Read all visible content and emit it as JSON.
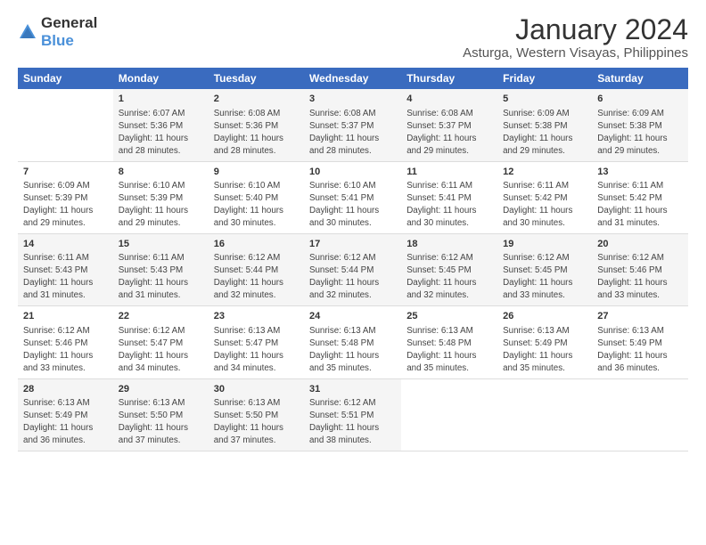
{
  "logo": {
    "general": "General",
    "blue": "Blue"
  },
  "title": "January 2024",
  "subtitle": "Asturga, Western Visayas, Philippines",
  "days_of_week": [
    "Sunday",
    "Monday",
    "Tuesday",
    "Wednesday",
    "Thursday",
    "Friday",
    "Saturday"
  ],
  "weeks": [
    [
      {
        "day": "",
        "info": ""
      },
      {
        "day": "1",
        "info": "Sunrise: 6:07 AM\nSunset: 5:36 PM\nDaylight: 11 hours\nand 28 minutes."
      },
      {
        "day": "2",
        "info": "Sunrise: 6:08 AM\nSunset: 5:36 PM\nDaylight: 11 hours\nand 28 minutes."
      },
      {
        "day": "3",
        "info": "Sunrise: 6:08 AM\nSunset: 5:37 PM\nDaylight: 11 hours\nand 28 minutes."
      },
      {
        "day": "4",
        "info": "Sunrise: 6:08 AM\nSunset: 5:37 PM\nDaylight: 11 hours\nand 29 minutes."
      },
      {
        "day": "5",
        "info": "Sunrise: 6:09 AM\nSunset: 5:38 PM\nDaylight: 11 hours\nand 29 minutes."
      },
      {
        "day": "6",
        "info": "Sunrise: 6:09 AM\nSunset: 5:38 PM\nDaylight: 11 hours\nand 29 minutes."
      }
    ],
    [
      {
        "day": "7",
        "info": "Sunrise: 6:09 AM\nSunset: 5:39 PM\nDaylight: 11 hours\nand 29 minutes."
      },
      {
        "day": "8",
        "info": "Sunrise: 6:10 AM\nSunset: 5:39 PM\nDaylight: 11 hours\nand 29 minutes."
      },
      {
        "day": "9",
        "info": "Sunrise: 6:10 AM\nSunset: 5:40 PM\nDaylight: 11 hours\nand 30 minutes."
      },
      {
        "day": "10",
        "info": "Sunrise: 6:10 AM\nSunset: 5:41 PM\nDaylight: 11 hours\nand 30 minutes."
      },
      {
        "day": "11",
        "info": "Sunrise: 6:11 AM\nSunset: 5:41 PM\nDaylight: 11 hours\nand 30 minutes."
      },
      {
        "day": "12",
        "info": "Sunrise: 6:11 AM\nSunset: 5:42 PM\nDaylight: 11 hours\nand 30 minutes."
      },
      {
        "day": "13",
        "info": "Sunrise: 6:11 AM\nSunset: 5:42 PM\nDaylight: 11 hours\nand 31 minutes."
      }
    ],
    [
      {
        "day": "14",
        "info": "Sunrise: 6:11 AM\nSunset: 5:43 PM\nDaylight: 11 hours\nand 31 minutes."
      },
      {
        "day": "15",
        "info": "Sunrise: 6:11 AM\nSunset: 5:43 PM\nDaylight: 11 hours\nand 31 minutes."
      },
      {
        "day": "16",
        "info": "Sunrise: 6:12 AM\nSunset: 5:44 PM\nDaylight: 11 hours\nand 32 minutes."
      },
      {
        "day": "17",
        "info": "Sunrise: 6:12 AM\nSunset: 5:44 PM\nDaylight: 11 hours\nand 32 minutes."
      },
      {
        "day": "18",
        "info": "Sunrise: 6:12 AM\nSunset: 5:45 PM\nDaylight: 11 hours\nand 32 minutes."
      },
      {
        "day": "19",
        "info": "Sunrise: 6:12 AM\nSunset: 5:45 PM\nDaylight: 11 hours\nand 33 minutes."
      },
      {
        "day": "20",
        "info": "Sunrise: 6:12 AM\nSunset: 5:46 PM\nDaylight: 11 hours\nand 33 minutes."
      }
    ],
    [
      {
        "day": "21",
        "info": "Sunrise: 6:12 AM\nSunset: 5:46 PM\nDaylight: 11 hours\nand 33 minutes."
      },
      {
        "day": "22",
        "info": "Sunrise: 6:12 AM\nSunset: 5:47 PM\nDaylight: 11 hours\nand 34 minutes."
      },
      {
        "day": "23",
        "info": "Sunrise: 6:13 AM\nSunset: 5:47 PM\nDaylight: 11 hours\nand 34 minutes."
      },
      {
        "day": "24",
        "info": "Sunrise: 6:13 AM\nSunset: 5:48 PM\nDaylight: 11 hours\nand 35 minutes."
      },
      {
        "day": "25",
        "info": "Sunrise: 6:13 AM\nSunset: 5:48 PM\nDaylight: 11 hours\nand 35 minutes."
      },
      {
        "day": "26",
        "info": "Sunrise: 6:13 AM\nSunset: 5:49 PM\nDaylight: 11 hours\nand 35 minutes."
      },
      {
        "day": "27",
        "info": "Sunrise: 6:13 AM\nSunset: 5:49 PM\nDaylight: 11 hours\nand 36 minutes."
      }
    ],
    [
      {
        "day": "28",
        "info": "Sunrise: 6:13 AM\nSunset: 5:49 PM\nDaylight: 11 hours\nand 36 minutes."
      },
      {
        "day": "29",
        "info": "Sunrise: 6:13 AM\nSunset: 5:50 PM\nDaylight: 11 hours\nand 37 minutes."
      },
      {
        "day": "30",
        "info": "Sunrise: 6:13 AM\nSunset: 5:50 PM\nDaylight: 11 hours\nand 37 minutes."
      },
      {
        "day": "31",
        "info": "Sunrise: 6:12 AM\nSunset: 5:51 PM\nDaylight: 11 hours\nand 38 minutes."
      },
      {
        "day": "",
        "info": ""
      },
      {
        "day": "",
        "info": ""
      },
      {
        "day": "",
        "info": ""
      }
    ]
  ]
}
